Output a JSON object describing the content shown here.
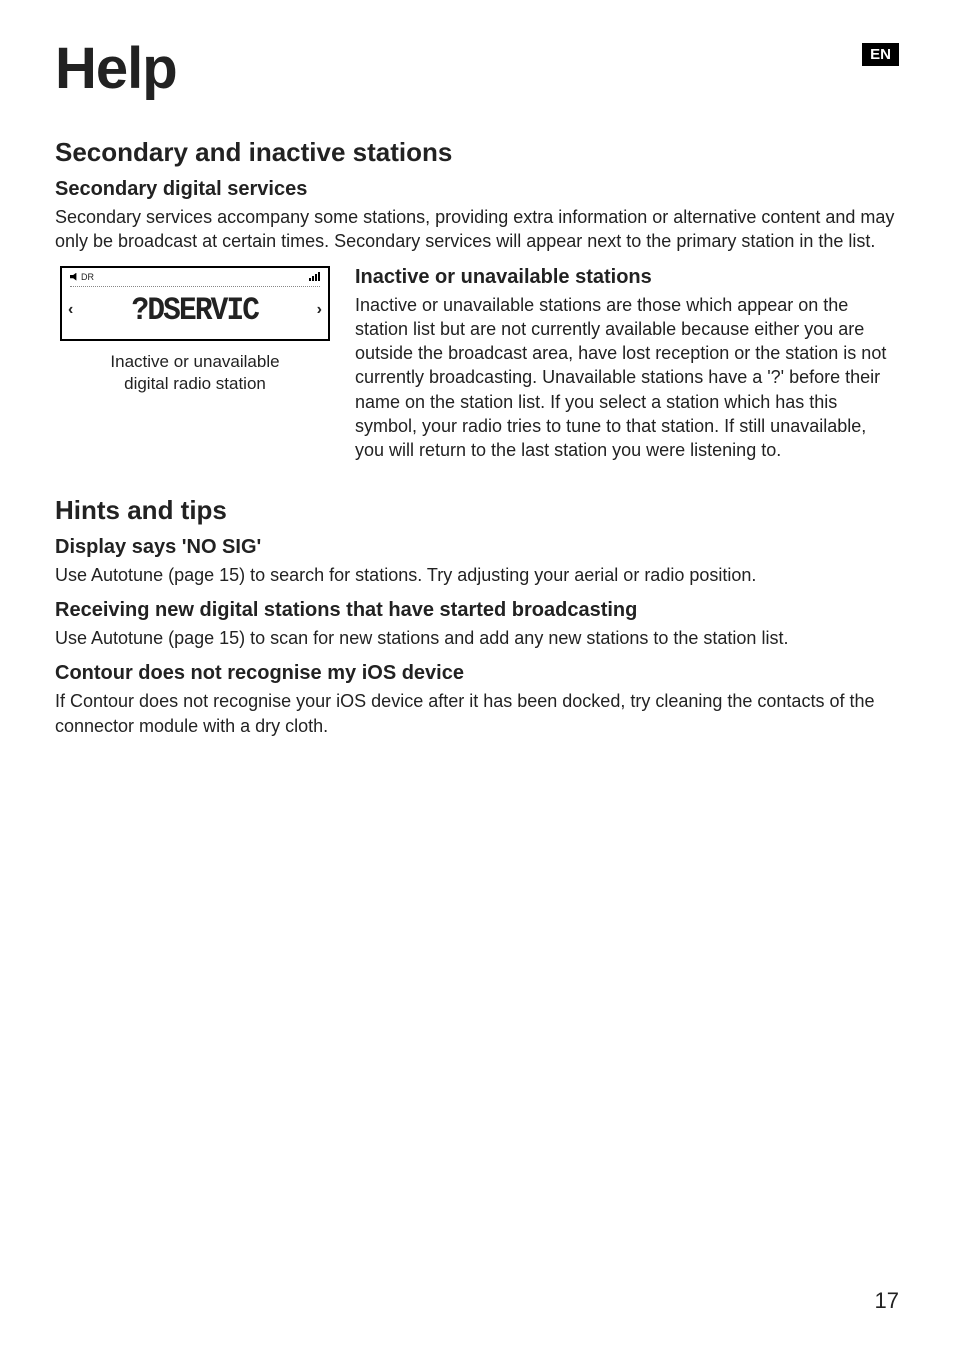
{
  "header": {
    "title": "Help",
    "lang": "EN"
  },
  "section1": {
    "heading": "Secondary and inactive stations",
    "sub1": {
      "heading": "Secondary digital services",
      "body": "Secondary services accompany some stations, providing extra information or alternative content and may only be broadcast at certain times. Secondary services will appear next to the primary station in the list."
    },
    "display": {
      "mode_label": "DR",
      "main_text": "?DSERVIC",
      "caption_line1": "Inactive or unavailable",
      "caption_line2": "digital radio station"
    },
    "sub2": {
      "heading": "Inactive or unavailable stations",
      "body": "Inactive or unavailable stations are those which appear on the station list but are not currently available because either you are outside the broadcast area, have lost reception or the station is not currently broadcasting. Unavailable stations have a '?' before their name on the station list. If you select a station which has this symbol, your radio tries to tune to that station. If still unavailable, you will return to the last station you were listening to."
    }
  },
  "section2": {
    "heading": "Hints and tips",
    "sub1": {
      "heading": "Display says 'NO SIG'",
      "body": "Use Autotune (page 15) to search for stations. Try adjusting your aerial or radio position."
    },
    "sub2": {
      "heading": "Receiving new digital stations that have started broadcasting",
      "body": "Use Autotune (page 15) to scan for new stations and add any new stations to the station list."
    },
    "sub3": {
      "heading": "Contour does not recognise my iOS device",
      "body": "If Contour does not recognise your iOS device after it has been docked, try cleaning the contacts of the connector module with a dry cloth."
    }
  },
  "page_number": "17"
}
